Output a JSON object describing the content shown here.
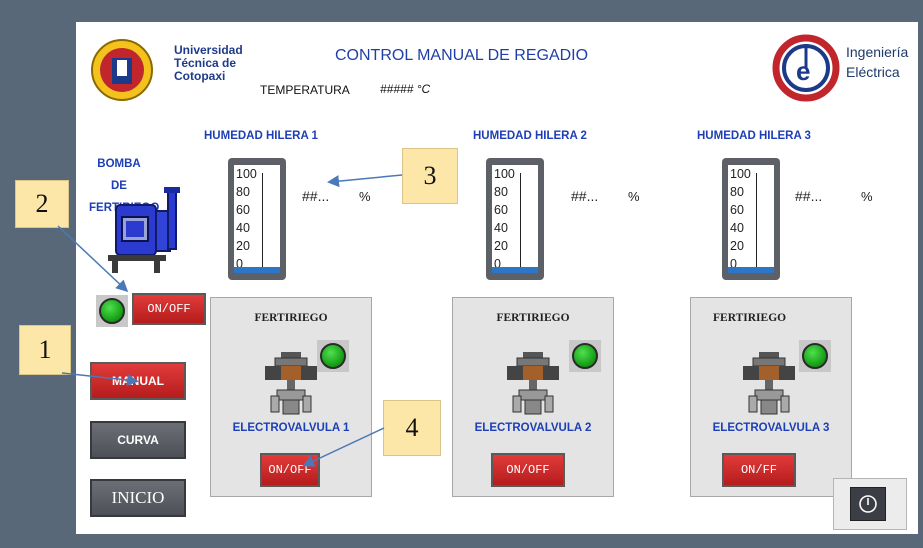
{
  "header": {
    "university_line1": "Universidad",
    "university_line2": "Técnica de",
    "university_line3": "Cotopaxi",
    "title": "CONTROL MANUAL DE REGADIO",
    "temperature_label": "TEMPERATURA",
    "temperature_value": "##### °C",
    "brand_line1": "Ingeniería",
    "brand_line2": "Eléctrica"
  },
  "pump": {
    "label_line1": "BOMBA DE",
    "label_line2": "FERTIRIEGO",
    "onoff_label": "ON/OFF"
  },
  "nav": {
    "manual_label": "MANUAL",
    "curva_label": "CURVA",
    "inicio_label": "INICIO"
  },
  "gauge_ticks": [
    "100",
    "80",
    "60",
    "40",
    "20",
    "0"
  ],
  "rows": [
    {
      "title": "HUMEDAD HILERA 1",
      "value": "##...",
      "unit": "%",
      "ferti_label": "FERTIRIEGO",
      "valve_label": "ELECTROVALVULA 1",
      "button_label": "ON/OFF"
    },
    {
      "title": "HUMEDAD HILERA 2",
      "value": "##...",
      "unit": "%",
      "ferti_label": "FERTIRIEGO",
      "valve_label": "ELECTROVALVULA 2",
      "button_label": "ON/OFF"
    },
    {
      "title": "HUMEDAD HILERA 3",
      "value": "##...",
      "unit": "%",
      "ferti_label": "FERTIRIEGO",
      "valve_label": "ELECTROVALVULA 3",
      "button_label": "ON/FF"
    }
  ],
  "callouts": [
    "1",
    "2",
    "3",
    "4"
  ],
  "colors": {
    "led_on": "#22b522",
    "button_red": "#d62b2b",
    "title_blue": "#1f3fa8"
  }
}
